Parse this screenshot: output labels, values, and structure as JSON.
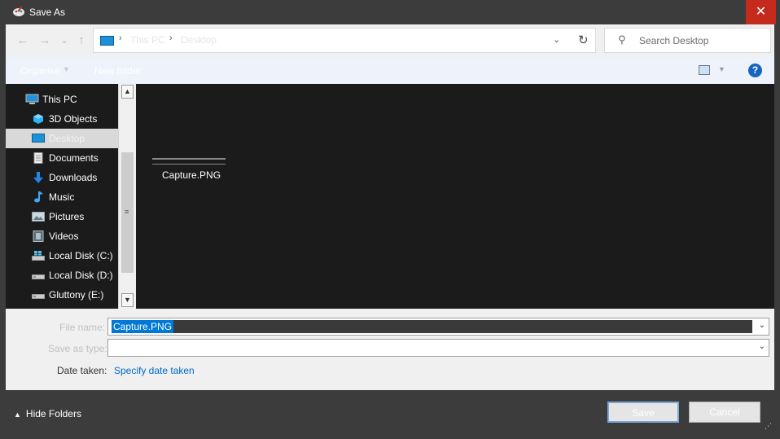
{
  "window": {
    "title": "Save As",
    "close_glyph": "✕"
  },
  "nav": {
    "back_glyph": "←",
    "forward_glyph": "→",
    "recent_glyph": "⌄",
    "up_glyph": "↑",
    "breadcrumb": [
      "This PC",
      "Desktop"
    ],
    "breadcrumb_sep": "›",
    "address_dropdown": "⌄",
    "refresh_glyph": "↻",
    "search_placeholder": "Search Desktop",
    "search_icon": "⚲"
  },
  "toolbar": {
    "organise_label": "Organise",
    "new_folder_label": "New folder",
    "help_label": "?"
  },
  "sidebar": {
    "items": [
      {
        "label": "This PC",
        "icon": "computer-icon",
        "level": 0
      },
      {
        "label": "3D Objects",
        "icon": "cube-icon",
        "level": 1
      },
      {
        "label": "Desktop",
        "icon": "desktop-icon",
        "level": 1,
        "selected": true
      },
      {
        "label": "Documents",
        "icon": "document-icon",
        "level": 1
      },
      {
        "label": "Downloads",
        "icon": "download-arrow-icon",
        "level": 1
      },
      {
        "label": "Music",
        "icon": "music-note-icon",
        "level": 1
      },
      {
        "label": "Pictures",
        "icon": "picture-icon",
        "level": 1
      },
      {
        "label": "Videos",
        "icon": "film-icon",
        "level": 1
      },
      {
        "label": "Local Disk (C:)",
        "icon": "system-drive-icon",
        "level": 1
      },
      {
        "label": "Local Disk (D:)",
        "icon": "drive-icon",
        "level": 1
      },
      {
        "label": "Gluttony (E:)",
        "icon": "drive-icon",
        "level": 1
      }
    ],
    "scroll_up": "▲",
    "scroll_down": "▼",
    "grip": "≡"
  },
  "files": [
    {
      "name": "Capture.PNG"
    }
  ],
  "form": {
    "file_name_label": "File name:",
    "file_name_value": "Capture.PNG",
    "save_as_type_label": "Save as type:",
    "save_as_type_value": "",
    "date_taken_label": "Date taken:",
    "date_taken_link": "Specify date taken",
    "dropdown_arrow": "⌄"
  },
  "footer": {
    "hide_folders_label": "Hide Folders",
    "hide_folders_chevron": "▲",
    "save_label": "Save",
    "cancel_label": "Cancel",
    "resize_grip": "⋰"
  }
}
